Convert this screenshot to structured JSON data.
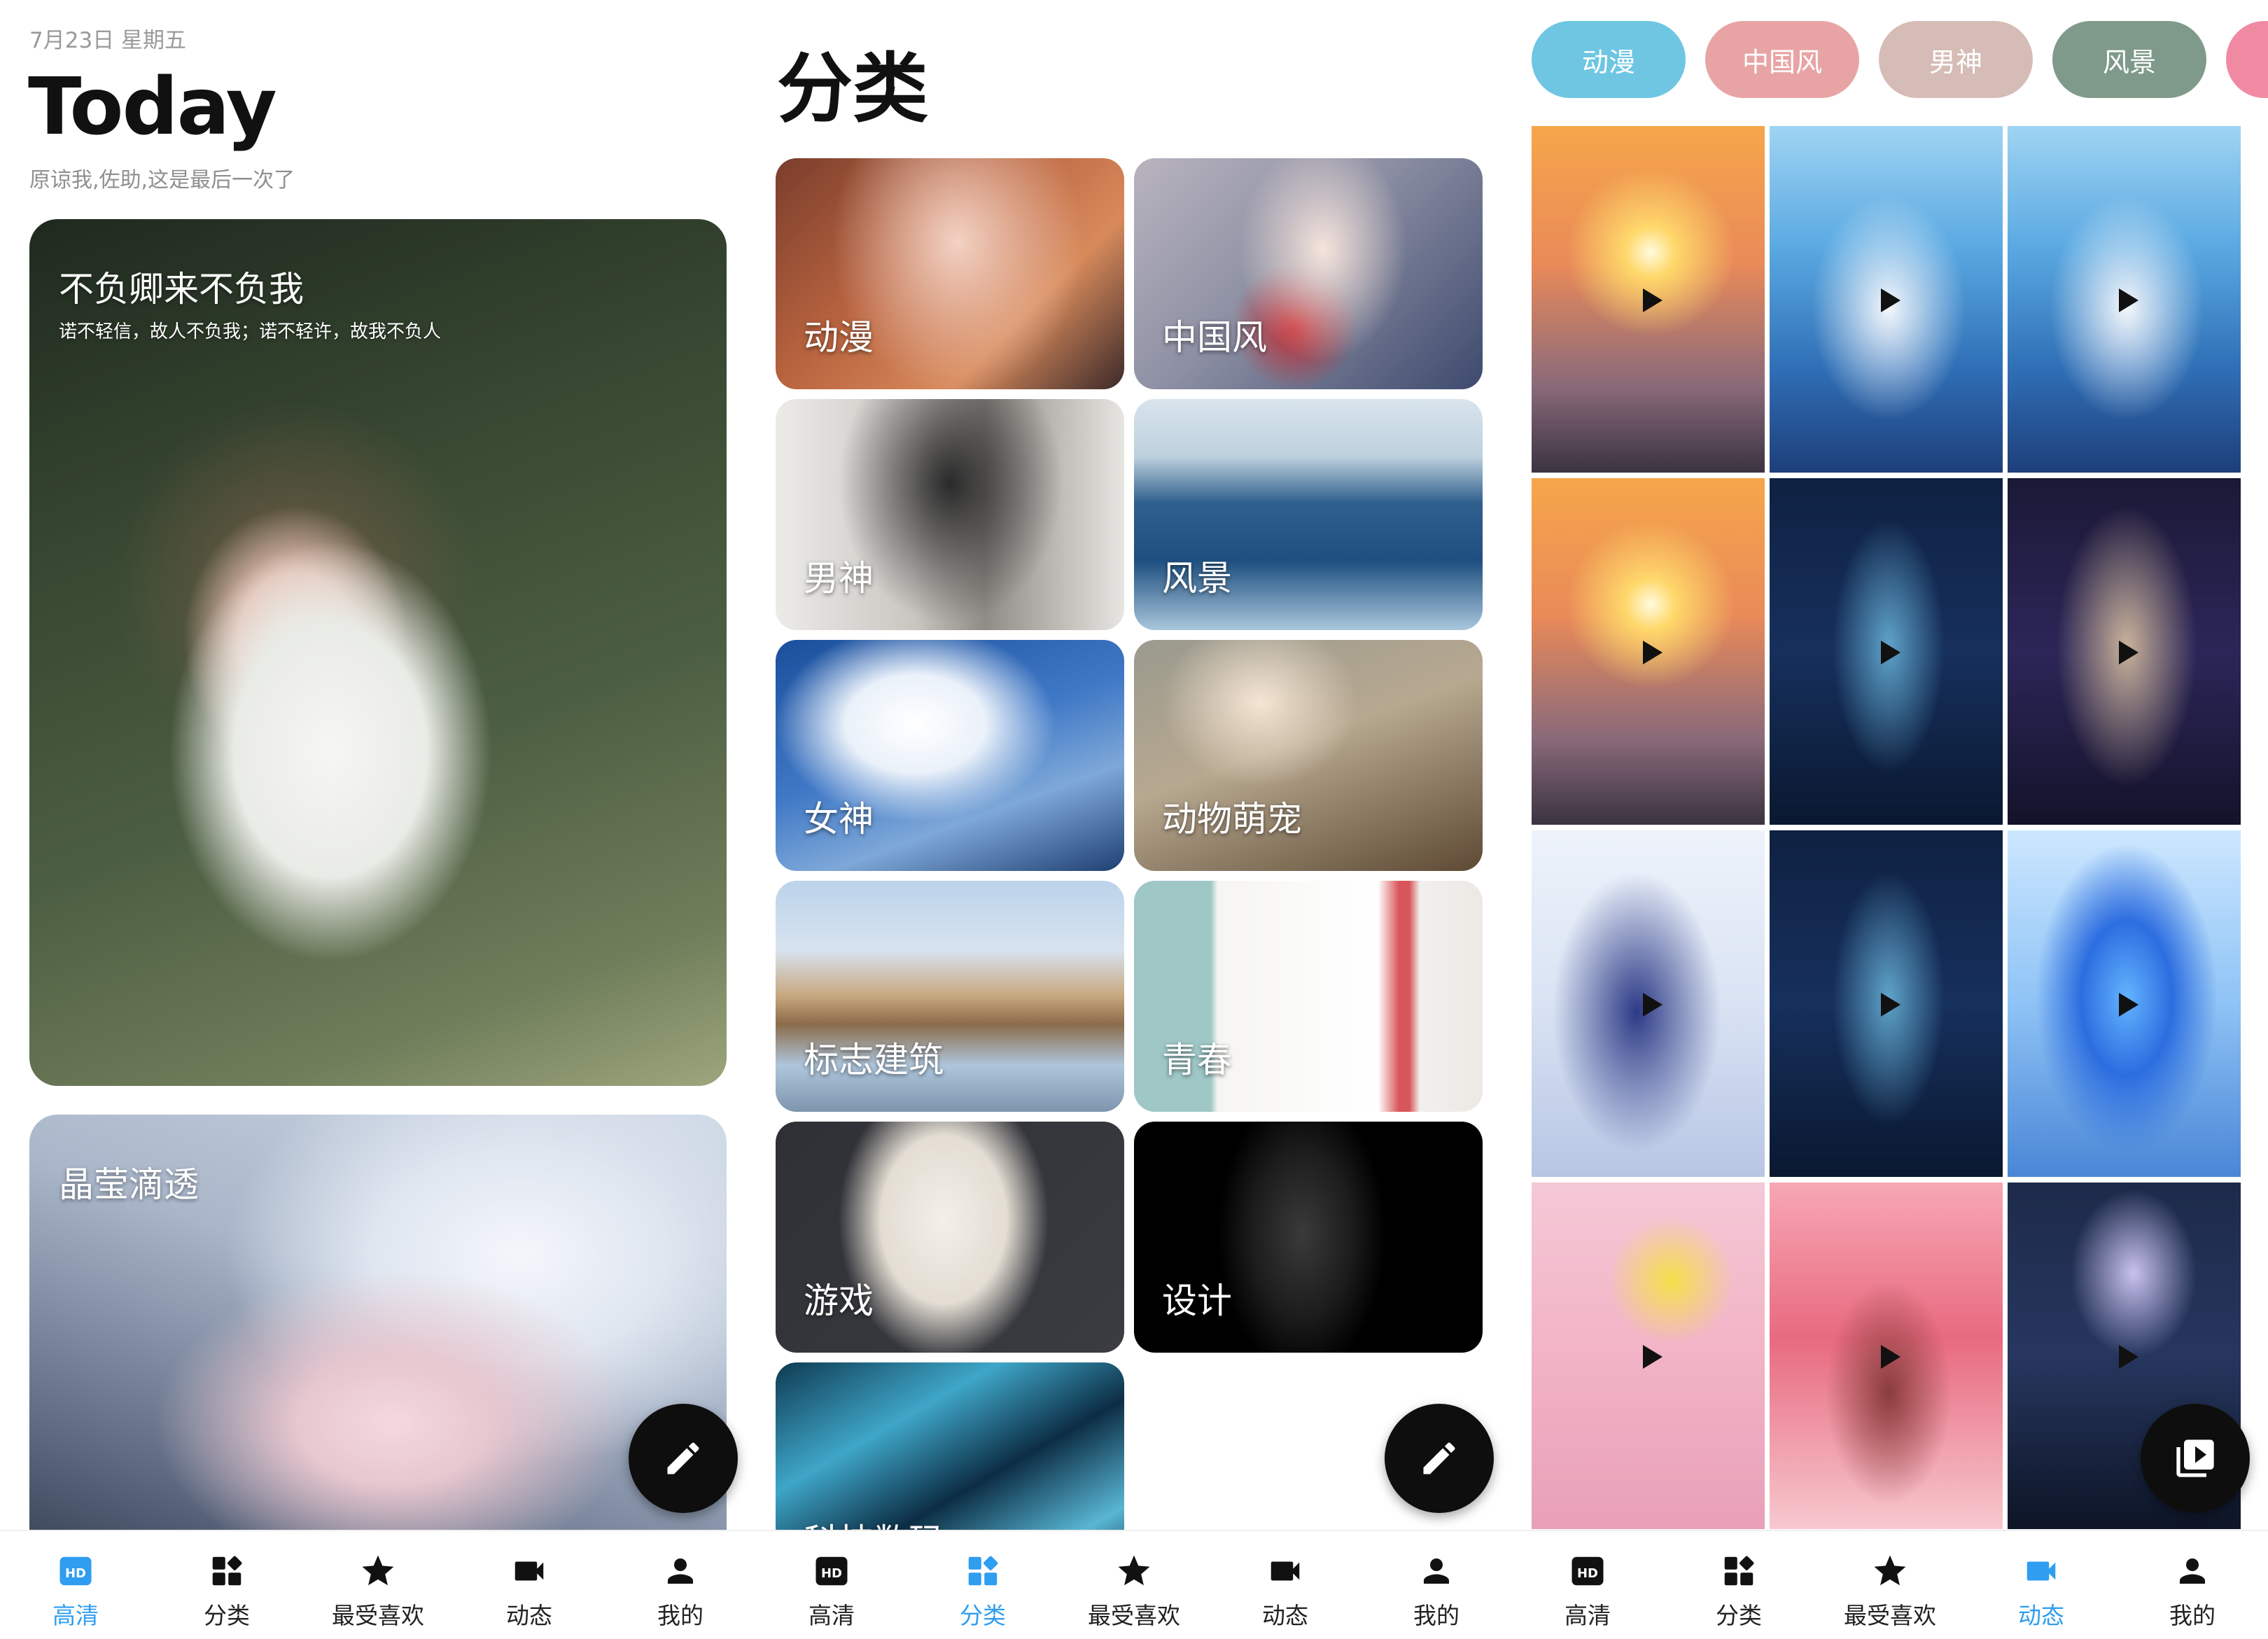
{
  "colors": {
    "accent": "#2f9df0",
    "text_primary": "#111111",
    "text_secondary": "#9a9a9a",
    "fab_bg": "#0e0e0e",
    "chip_anime": "#6ec6e2",
    "chip_chinese": "#e8a4a4",
    "chip_male": "#d6bcb6",
    "chip_scenery": "#7f9a8a",
    "chip_extra": "#f08aa2"
  },
  "today": {
    "date": "7月23日 星期五",
    "title": "Today",
    "subtitle": "原谅我,佐助,这是最后一次了",
    "cards": [
      {
        "title": "不负卿来不负我",
        "desc": "诺不轻信，故人不负我；诺不轻许，故我不负人"
      },
      {
        "title": "晶莹滴透"
      }
    ],
    "fab_icon": "pencil-icon"
  },
  "categories": {
    "heading": "分类",
    "items": [
      {
        "label": "动漫"
      },
      {
        "label": "中国风"
      },
      {
        "label": "男神"
      },
      {
        "label": "风景"
      },
      {
        "label": "女神"
      },
      {
        "label": "动物萌宠"
      },
      {
        "label": "标志建筑"
      },
      {
        "label": "青春"
      },
      {
        "label": "游戏"
      },
      {
        "label": "设计"
      },
      {
        "label": "科技数码"
      }
    ],
    "fab_icon": "pencil-icon"
  },
  "dynamic": {
    "chips": [
      {
        "label": "动漫"
      },
      {
        "label": "中国风"
      },
      {
        "label": "男神"
      },
      {
        "label": "风景"
      }
    ],
    "fab_icon": "video-library-icon"
  },
  "nav": {
    "items": [
      {
        "label": "高清",
        "icon": "hd-icon"
      },
      {
        "label": "分类",
        "icon": "category-icon"
      },
      {
        "label": "最受喜欢",
        "icon": "star-icon"
      },
      {
        "label": "动态",
        "icon": "videocam-icon"
      },
      {
        "label": "我的",
        "icon": "person-icon"
      }
    ],
    "active_by_panel": [
      "高清",
      "分类",
      "动态"
    ]
  }
}
